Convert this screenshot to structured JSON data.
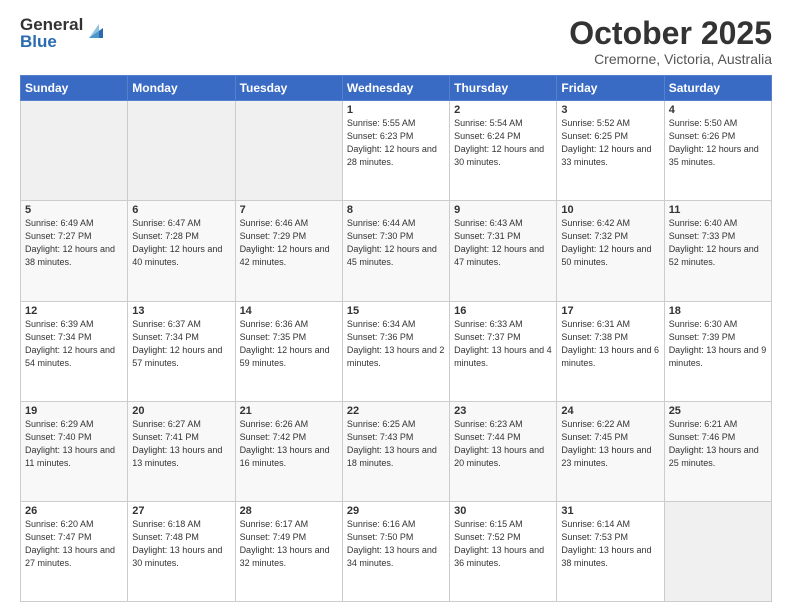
{
  "logo": {
    "general": "General",
    "blue": "Blue"
  },
  "header": {
    "month": "October 2025",
    "location": "Cremorne, Victoria, Australia"
  },
  "weekdays": [
    "Sunday",
    "Monday",
    "Tuesday",
    "Wednesday",
    "Thursday",
    "Friday",
    "Saturday"
  ],
  "weeks": [
    [
      {
        "day": "",
        "info": ""
      },
      {
        "day": "",
        "info": ""
      },
      {
        "day": "",
        "info": ""
      },
      {
        "day": "1",
        "info": "Sunrise: 5:55 AM\nSunset: 6:23 PM\nDaylight: 12 hours\nand 28 minutes."
      },
      {
        "day": "2",
        "info": "Sunrise: 5:54 AM\nSunset: 6:24 PM\nDaylight: 12 hours\nand 30 minutes."
      },
      {
        "day": "3",
        "info": "Sunrise: 5:52 AM\nSunset: 6:25 PM\nDaylight: 12 hours\nand 33 minutes."
      },
      {
        "day": "4",
        "info": "Sunrise: 5:50 AM\nSunset: 6:26 PM\nDaylight: 12 hours\nand 35 minutes."
      }
    ],
    [
      {
        "day": "5",
        "info": "Sunrise: 6:49 AM\nSunset: 7:27 PM\nDaylight: 12 hours\nand 38 minutes."
      },
      {
        "day": "6",
        "info": "Sunrise: 6:47 AM\nSunset: 7:28 PM\nDaylight: 12 hours\nand 40 minutes."
      },
      {
        "day": "7",
        "info": "Sunrise: 6:46 AM\nSunset: 7:29 PM\nDaylight: 12 hours\nand 42 minutes."
      },
      {
        "day": "8",
        "info": "Sunrise: 6:44 AM\nSunset: 7:30 PM\nDaylight: 12 hours\nand 45 minutes."
      },
      {
        "day": "9",
        "info": "Sunrise: 6:43 AM\nSunset: 7:31 PM\nDaylight: 12 hours\nand 47 minutes."
      },
      {
        "day": "10",
        "info": "Sunrise: 6:42 AM\nSunset: 7:32 PM\nDaylight: 12 hours\nand 50 minutes."
      },
      {
        "day": "11",
        "info": "Sunrise: 6:40 AM\nSunset: 7:33 PM\nDaylight: 12 hours\nand 52 minutes."
      }
    ],
    [
      {
        "day": "12",
        "info": "Sunrise: 6:39 AM\nSunset: 7:34 PM\nDaylight: 12 hours\nand 54 minutes."
      },
      {
        "day": "13",
        "info": "Sunrise: 6:37 AM\nSunset: 7:34 PM\nDaylight: 12 hours\nand 57 minutes."
      },
      {
        "day": "14",
        "info": "Sunrise: 6:36 AM\nSunset: 7:35 PM\nDaylight: 12 hours\nand 59 minutes."
      },
      {
        "day": "15",
        "info": "Sunrise: 6:34 AM\nSunset: 7:36 PM\nDaylight: 13 hours\nand 2 minutes."
      },
      {
        "day": "16",
        "info": "Sunrise: 6:33 AM\nSunset: 7:37 PM\nDaylight: 13 hours\nand 4 minutes."
      },
      {
        "day": "17",
        "info": "Sunrise: 6:31 AM\nSunset: 7:38 PM\nDaylight: 13 hours\nand 6 minutes."
      },
      {
        "day": "18",
        "info": "Sunrise: 6:30 AM\nSunset: 7:39 PM\nDaylight: 13 hours\nand 9 minutes."
      }
    ],
    [
      {
        "day": "19",
        "info": "Sunrise: 6:29 AM\nSunset: 7:40 PM\nDaylight: 13 hours\nand 11 minutes."
      },
      {
        "day": "20",
        "info": "Sunrise: 6:27 AM\nSunset: 7:41 PM\nDaylight: 13 hours\nand 13 minutes."
      },
      {
        "day": "21",
        "info": "Sunrise: 6:26 AM\nSunset: 7:42 PM\nDaylight: 13 hours\nand 16 minutes."
      },
      {
        "day": "22",
        "info": "Sunrise: 6:25 AM\nSunset: 7:43 PM\nDaylight: 13 hours\nand 18 minutes."
      },
      {
        "day": "23",
        "info": "Sunrise: 6:23 AM\nSunset: 7:44 PM\nDaylight: 13 hours\nand 20 minutes."
      },
      {
        "day": "24",
        "info": "Sunrise: 6:22 AM\nSunset: 7:45 PM\nDaylight: 13 hours\nand 23 minutes."
      },
      {
        "day": "25",
        "info": "Sunrise: 6:21 AM\nSunset: 7:46 PM\nDaylight: 13 hours\nand 25 minutes."
      }
    ],
    [
      {
        "day": "26",
        "info": "Sunrise: 6:20 AM\nSunset: 7:47 PM\nDaylight: 13 hours\nand 27 minutes."
      },
      {
        "day": "27",
        "info": "Sunrise: 6:18 AM\nSunset: 7:48 PM\nDaylight: 13 hours\nand 30 minutes."
      },
      {
        "day": "28",
        "info": "Sunrise: 6:17 AM\nSunset: 7:49 PM\nDaylight: 13 hours\nand 32 minutes."
      },
      {
        "day": "29",
        "info": "Sunrise: 6:16 AM\nSunset: 7:50 PM\nDaylight: 13 hours\nand 34 minutes."
      },
      {
        "day": "30",
        "info": "Sunrise: 6:15 AM\nSunset: 7:52 PM\nDaylight: 13 hours\nand 36 minutes."
      },
      {
        "day": "31",
        "info": "Sunrise: 6:14 AM\nSunset: 7:53 PM\nDaylight: 13 hours\nand 38 minutes."
      },
      {
        "day": "",
        "info": ""
      }
    ]
  ]
}
